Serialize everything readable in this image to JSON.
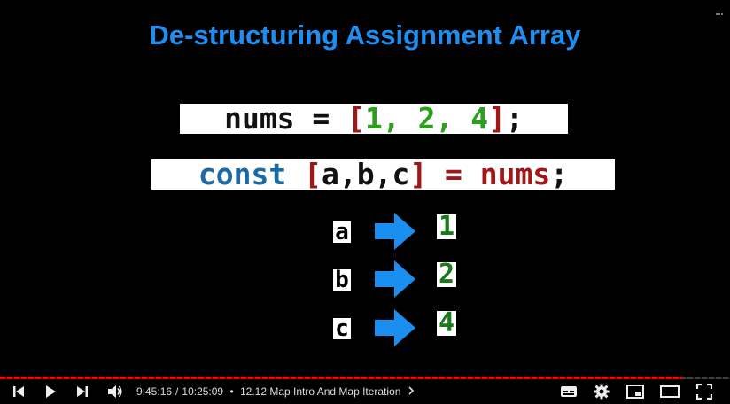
{
  "slide": {
    "title": "De-structuring Assignment Array",
    "line1": {
      "nums": "nums",
      "eq": " = ",
      "open": "[",
      "v1": "1",
      "c1": ", ",
      "v2": "2",
      "c2": ", ",
      "v3": "4",
      "close": "]",
      "semi": ";"
    },
    "line2": {
      "kw": "const",
      "sp": " ",
      "open": "[",
      "a": "a",
      "c1": ",",
      "b": "b",
      "c2": ",",
      "c": "c",
      "close": "]",
      "eq": " = ",
      "nums": "nums",
      "semi": ";"
    },
    "mappings": [
      {
        "var": "a",
        "value": "1"
      },
      {
        "var": "b",
        "value": "2"
      },
      {
        "var": "c",
        "value": "4"
      }
    ]
  },
  "player": {
    "current_time": "9:45:16",
    "separator": "/",
    "duration": "10:25:09",
    "bullet": "•",
    "chapter": "12.12 Map Intro And Map Iteration",
    "progress_fraction": 0.935,
    "colors": {
      "progress": "#ff0000",
      "title": "#1f8ef1"
    },
    "icons": [
      "previous-icon",
      "play-icon",
      "next-icon",
      "volume-icon",
      "chevron-right-icon",
      "subtitles-icon",
      "settings-icon",
      "miniplayer-icon",
      "theater-mode-icon",
      "fullscreen-icon"
    ]
  }
}
